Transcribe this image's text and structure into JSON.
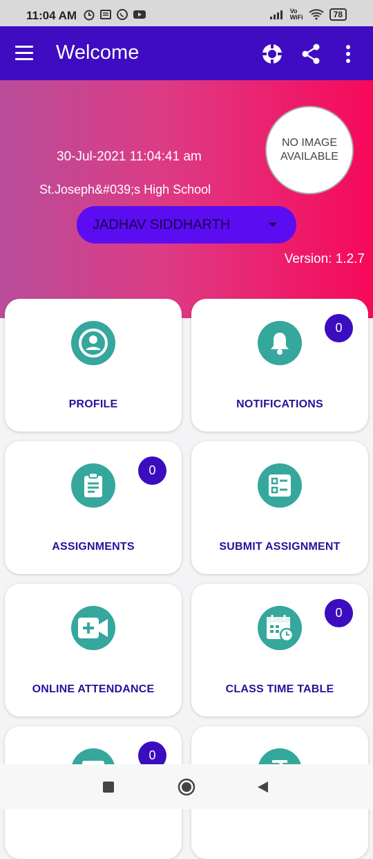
{
  "status_bar": {
    "time": "11:04 AM",
    "left_icons": [
      "alarm-icon",
      "message-icon",
      "whatsapp-icon",
      "youtube-icon"
    ],
    "right_icons": [
      "signal-icon",
      "volte-icon",
      "wifi-icon"
    ],
    "volte_label": "Vo\nWiFi",
    "battery_level": "78"
  },
  "app_bar": {
    "title": "Welcome",
    "actions": [
      "help-icon",
      "share-icon",
      "more-icon"
    ]
  },
  "header": {
    "datetime": "30-Jul-2021 11:04:41 am",
    "school": "St.Joseph&#039;s High School",
    "avatar_text": "NO IMAGE AVAILABLE",
    "student_select": "JADHAV SIDDHARTH",
    "version": "Version: 1.2.7",
    "colors": {
      "gradient_start": "#b84d9a",
      "gradient_end": "#f7095a",
      "select": "#5b0cf0"
    }
  },
  "cards": [
    {
      "label": "PROFILE",
      "icon": "profile-icon",
      "badge": null
    },
    {
      "label": "NOTIFICATIONS",
      "icon": "bell-icon",
      "badge": "0"
    },
    {
      "label": "ASSIGNMENTS",
      "icon": "clipboard-icon",
      "badge": "0"
    },
    {
      "label": "SUBMIT ASSIGNMENT",
      "icon": "checklist-icon",
      "badge": null
    },
    {
      "label": "ONLINE ATTENDANCE",
      "icon": "video-add-icon",
      "badge": null
    },
    {
      "label": "CLASS TIME TABLE",
      "icon": "calendar-clock-icon",
      "badge": "0"
    },
    {
      "label": "",
      "icon": "message-icon",
      "badge": "0"
    },
    {
      "label": "",
      "icon": "rupee-icon",
      "badge": null
    }
  ],
  "colors": {
    "app_bar": "#3f0cc2",
    "icon_bg": "#35a79c",
    "label": "#2c0f9b",
    "badge": "#3a0dbf"
  },
  "nav": [
    "recents-button",
    "home-button",
    "back-button"
  ]
}
